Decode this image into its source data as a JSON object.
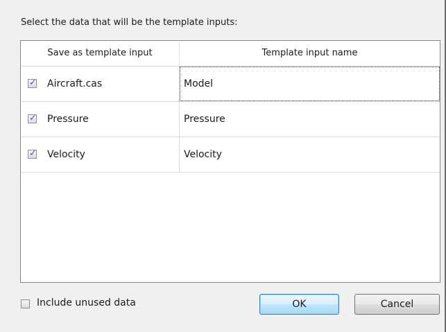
{
  "instruction": "Select the data that will be the template inputs:",
  "table": {
    "headers": [
      "Save as template input",
      "Template input name"
    ],
    "rows": [
      {
        "data": "Aircraft.cas",
        "checked": true,
        "name": "Model",
        "focused": true
      },
      {
        "data": "Pressure",
        "checked": true,
        "name": "Pressure",
        "focused": false
      },
      {
        "data": "Velocity",
        "checked": true,
        "name": "Velocity",
        "focused": false
      }
    ]
  },
  "include_unused": {
    "label": "Include unused data",
    "checked": false
  },
  "buttons": {
    "ok": "OK",
    "cancel": "Cancel"
  },
  "colors": {
    "checkmark": "#3a5fcd",
    "ok_border": "#3c7fb1"
  }
}
